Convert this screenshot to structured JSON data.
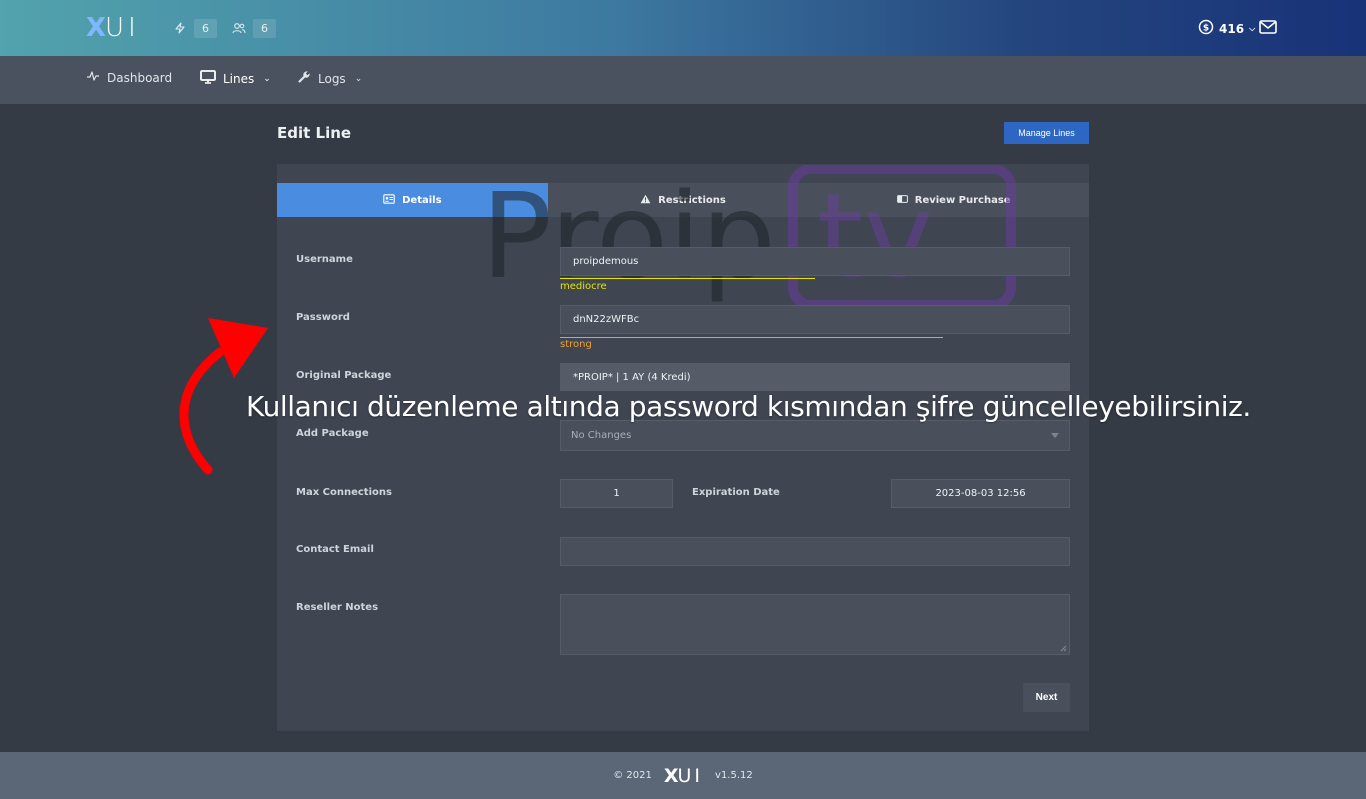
{
  "header": {
    "logo_x": "X",
    "logo_ui": "UI",
    "stats": [
      {
        "icon": "bolt-icon",
        "value": "6"
      },
      {
        "icon": "users-icon",
        "value": "6"
      }
    ],
    "credits": "416",
    "credits_icon": "dollar-circle-icon",
    "mail_icon": "mail-icon"
  },
  "nav": {
    "items": [
      {
        "label": "Dashboard",
        "icon": "activity-icon"
      },
      {
        "label": "Lines",
        "icon": "monitor-icon"
      },
      {
        "label": "Logs",
        "icon": "wrench-icon"
      }
    ]
  },
  "page": {
    "title": "Edit Line",
    "manage_button": "Manage Lines"
  },
  "tabs": [
    {
      "label": "Details",
      "icon": "id-card-icon"
    },
    {
      "label": "Restrictions",
      "icon": "warning-icon"
    },
    {
      "label": "Review Purchase",
      "icon": "toggle-icon"
    }
  ],
  "watermark": {
    "text1": "Proip",
    "text2": "tv"
  },
  "form": {
    "username_label": "Username",
    "username_value": "proipdemous",
    "username_strength": "mediocre",
    "password_label": "Password",
    "password_value": "dnN22zWFBc",
    "password_strength": "strong",
    "original_package_label": "Original Package",
    "original_package_value": "*PROIP* | 1 AY (4 Kredi)",
    "add_package_label": "Add Package",
    "add_package_value": "No Changes",
    "max_connections_label": "Max Connections",
    "max_connections_value": "1",
    "expiration_label": "Expiration Date",
    "expiration_value": "2023-08-03 12:56",
    "contact_email_label": "Contact Email",
    "contact_email_value": "",
    "reseller_notes_label": "Reseller Notes",
    "reseller_notes_value": "",
    "next_button": "Next"
  },
  "overlay": {
    "caption": "Kullanıcı düzenleme altında password kısmından şifre güncelleyebilirsiniz."
  },
  "footer": {
    "copyright": "© 2021",
    "logo_x": "X",
    "logo_ui": "UI",
    "version": "v1.5.12"
  },
  "colors": {
    "accent": "#4a8de0",
    "manage_button": "#2e66c3",
    "mediocre": "#e6e600",
    "strong": "#f0a030",
    "arrow": "#ff0000",
    "watermark_purple": "#6a3da0"
  }
}
